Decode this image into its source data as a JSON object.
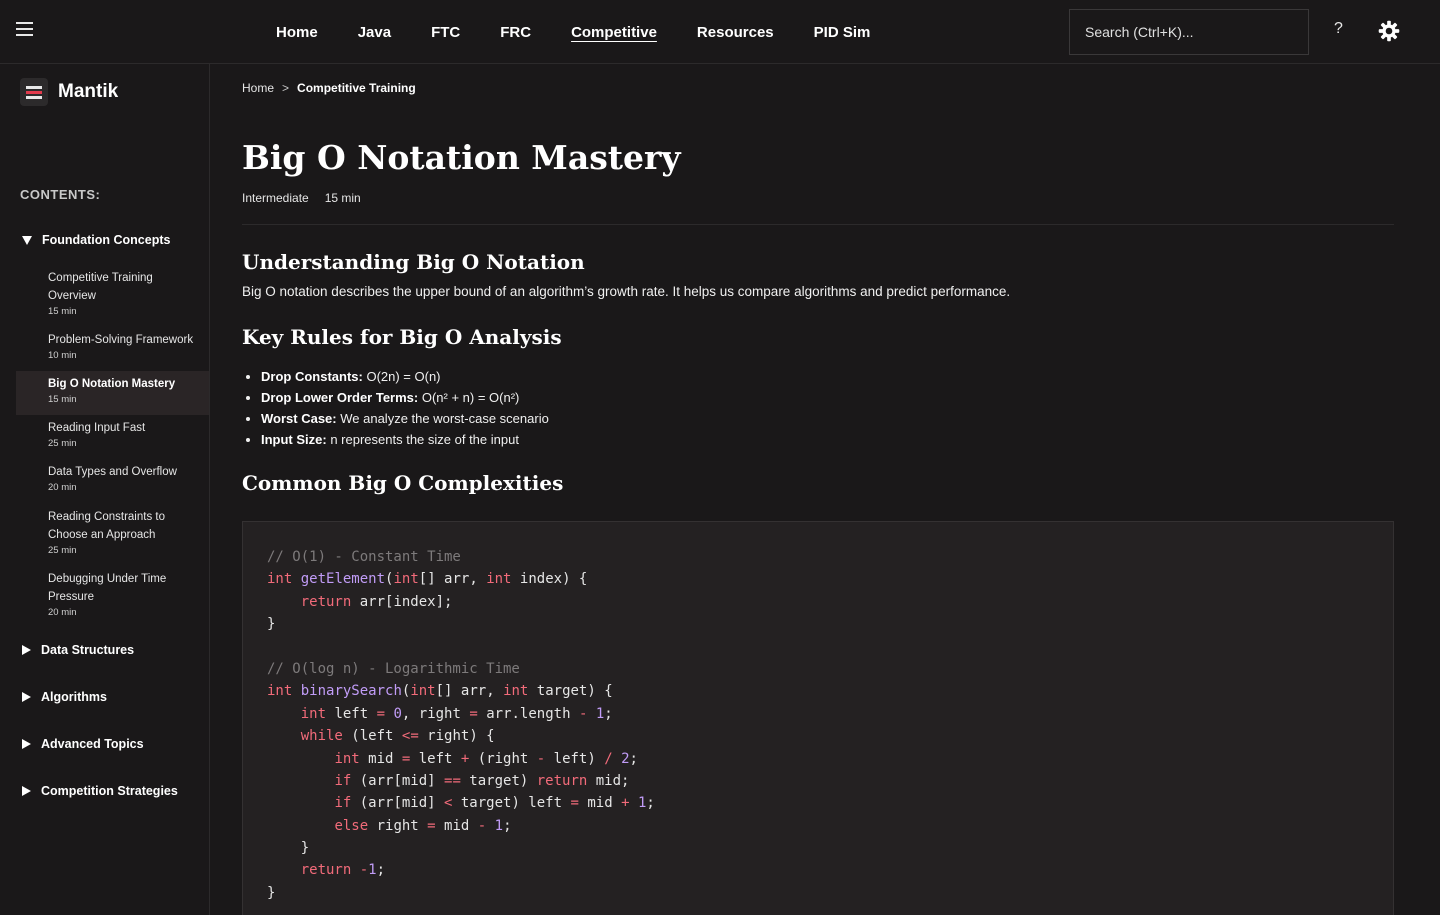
{
  "nav": {
    "items": [
      {
        "label": "Home"
      },
      {
        "label": "Java"
      },
      {
        "label": "FTC"
      },
      {
        "label": "FRC"
      },
      {
        "label": "Competitive",
        "active": true
      },
      {
        "label": "Resources"
      },
      {
        "label": "PID Sim"
      }
    ],
    "search_placeholder": "Search (Ctrl+K)...",
    "help_label": "?"
  },
  "brand": {
    "name": "Mantik"
  },
  "sidebar": {
    "contents_label": "CONTENTS:",
    "sections": [
      {
        "title": "Foundation Concepts",
        "expanded": true,
        "items": [
          {
            "title": "Competitive Training Overview",
            "time": "15 min"
          },
          {
            "title": "Problem-Solving Framework",
            "time": "10 min"
          },
          {
            "title": "Big O Notation Mastery",
            "time": "15 min",
            "active": true
          },
          {
            "title": "Reading Input Fast",
            "time": "25 min"
          },
          {
            "title": "Data Types and Overflow",
            "time": "20 min"
          },
          {
            "title": "Reading Constraints to Choose an Approach",
            "time": "25 min"
          },
          {
            "title": "Debugging Under Time Pressure",
            "time": "20 min"
          }
        ]
      },
      {
        "title": "Data Structures",
        "expanded": false
      },
      {
        "title": "Algorithms",
        "expanded": false
      },
      {
        "title": "Advanced Topics",
        "expanded": false
      },
      {
        "title": "Competition Strategies",
        "expanded": false
      }
    ]
  },
  "breadcrumb": {
    "home": "Home",
    "separator": ">",
    "current": "Competitive Training"
  },
  "page": {
    "title": "Big O Notation Mastery",
    "level": "Intermediate",
    "duration": "15 min",
    "section1_title": "Understanding Big O Notation",
    "section1_text": "Big O notation describes the upper bound of an algorithm’s growth rate. It helps us compare algorithms and predict performance.",
    "section2_title": "Key Rules for Big O Analysis",
    "rules": [
      {
        "term": "Drop Constants:",
        "text": " O(2n) = O(n)"
      },
      {
        "term": "Drop Lower Order Terms:",
        "text": " O(n² + n) = O(n²)"
      },
      {
        "term": "Worst Case:",
        "text": " We analyze the worst-case scenario"
      },
      {
        "term": "Input Size:",
        "text": " n represents the size of the input"
      }
    ],
    "section3_title": "Common Big O Complexities"
  },
  "code": {
    "lines": [
      [
        [
          "c",
          "// O(1) - Constant Time"
        ]
      ],
      [
        [
          "k",
          "int"
        ],
        [
          "p",
          " "
        ],
        [
          "f",
          "getElement"
        ],
        [
          "p",
          "("
        ],
        [
          "k",
          "int"
        ],
        [
          "p",
          "[] arr, "
        ],
        [
          "k",
          "int"
        ],
        [
          "p",
          " index) {"
        ]
      ],
      [
        [
          "p",
          "    "
        ],
        [
          "k",
          "return"
        ],
        [
          "p",
          " arr[index];"
        ]
      ],
      [
        [
          "p",
          "}"
        ]
      ],
      [],
      [
        [
          "c",
          "// O(log n) - Logarithmic Time"
        ]
      ],
      [
        [
          "k",
          "int"
        ],
        [
          "p",
          " "
        ],
        [
          "f",
          "binarySearch"
        ],
        [
          "p",
          "("
        ],
        [
          "k",
          "int"
        ],
        [
          "p",
          "[] arr, "
        ],
        [
          "k",
          "int"
        ],
        [
          "p",
          " target) {"
        ]
      ],
      [
        [
          "p",
          "    "
        ],
        [
          "k",
          "int"
        ],
        [
          "p",
          " left "
        ],
        [
          "o",
          "="
        ],
        [
          "p",
          " "
        ],
        [
          "n",
          "0"
        ],
        [
          "p",
          ", right "
        ],
        [
          "o",
          "="
        ],
        [
          "p",
          " arr.length "
        ],
        [
          "o",
          "-"
        ],
        [
          "p",
          " "
        ],
        [
          "n",
          "1"
        ],
        [
          "p",
          ";"
        ]
      ],
      [
        [
          "p",
          "    "
        ],
        [
          "k",
          "while"
        ],
        [
          "p",
          " (left "
        ],
        [
          "o",
          "<="
        ],
        [
          "p",
          " right) {"
        ]
      ],
      [
        [
          "p",
          "        "
        ],
        [
          "k",
          "int"
        ],
        [
          "p",
          " mid "
        ],
        [
          "o",
          "="
        ],
        [
          "p",
          " left "
        ],
        [
          "o",
          "+"
        ],
        [
          "p",
          " (right "
        ],
        [
          "o",
          "-"
        ],
        [
          "p",
          " left) "
        ],
        [
          "o",
          "/"
        ],
        [
          "p",
          " "
        ],
        [
          "n",
          "2"
        ],
        [
          "p",
          ";"
        ]
      ],
      [
        [
          "p",
          "        "
        ],
        [
          "k",
          "if"
        ],
        [
          "p",
          " (arr[mid] "
        ],
        [
          "o",
          "=="
        ],
        [
          "p",
          " target) "
        ],
        [
          "k",
          "return"
        ],
        [
          "p",
          " mid;"
        ]
      ],
      [
        [
          "p",
          "        "
        ],
        [
          "k",
          "if"
        ],
        [
          "p",
          " (arr[mid] "
        ],
        [
          "o",
          "<"
        ],
        [
          "p",
          " target) left "
        ],
        [
          "o",
          "="
        ],
        [
          "p",
          " mid "
        ],
        [
          "o",
          "+"
        ],
        [
          "p",
          " "
        ],
        [
          "n",
          "1"
        ],
        [
          "p",
          ";"
        ]
      ],
      [
        [
          "p",
          "        "
        ],
        [
          "k",
          "else"
        ],
        [
          "p",
          " right "
        ],
        [
          "o",
          "="
        ],
        [
          "p",
          " mid "
        ],
        [
          "o",
          "-"
        ],
        [
          "p",
          " "
        ],
        [
          "n",
          "1"
        ],
        [
          "p",
          ";"
        ]
      ],
      [
        [
          "p",
          "    }"
        ]
      ],
      [
        [
          "p",
          "    "
        ],
        [
          "k",
          "return"
        ],
        [
          "p",
          " "
        ],
        [
          "o",
          "-"
        ],
        [
          "n",
          "1"
        ],
        [
          "p",
          ";"
        ]
      ],
      [
        [
          "p",
          "}"
        ]
      ]
    ]
  },
  "colors": {
    "logo_bar_top": "#e8e8e8",
    "logo_bar_mid": "#e23a4c",
    "logo_bar_bottom": "#e8e8e8"
  }
}
